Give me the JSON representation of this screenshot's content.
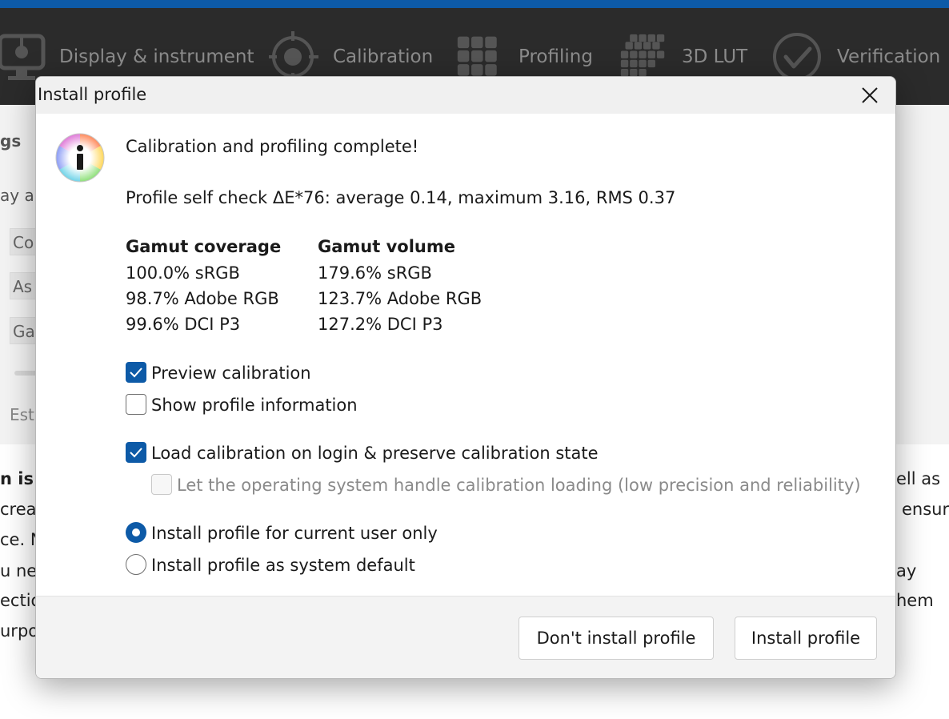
{
  "toolbar": {
    "items": [
      {
        "label": "Display & instrument",
        "icon": "display-icon"
      },
      {
        "label": "Calibration",
        "icon": "calibration-target-icon"
      },
      {
        "label": "Profiling",
        "icon": "profiling-grid-icon"
      },
      {
        "label": "3D LUT",
        "icon": "cube-icon"
      },
      {
        "label": "Verification",
        "icon": "checkmark-circle-icon"
      }
    ]
  },
  "background": {
    "heading": "gs",
    "sub": "ay a",
    "fields": [
      "Co",
      "As",
      "Ga"
    ],
    "est": "Est",
    "lines_left": [
      "n is",
      "crea",
      "ce. N",
      "u ne",
      "ectio",
      "urpos"
    ],
    "lines_right": [
      "ell as",
      "ensur",
      "ay",
      "hem"
    ]
  },
  "dialog": {
    "title": "Install profile",
    "headline": "Calibration and profiling complete!",
    "self_check": "Profile self check ΔE*76: average 0.14, maximum 3.16, RMS 0.37",
    "gamut_coverage": {
      "header": "Gamut coverage",
      "rows": [
        "100.0% sRGB",
        "98.7% Adobe RGB",
        "99.6% DCI P3"
      ]
    },
    "gamut_volume": {
      "header": "Gamut volume",
      "rows": [
        "179.6% sRGB",
        "123.7% Adobe RGB",
        "127.2% DCI P3"
      ]
    },
    "options": {
      "preview_calibration": {
        "label": "Preview calibration",
        "checked": true
      },
      "show_profile_info": {
        "label": "Show profile information",
        "checked": false
      },
      "load_calibration": {
        "label": "Load calibration on login & preserve calibration state",
        "checked": true
      },
      "os_handle": {
        "label": "Let the operating system handle calibration loading (low precision and reliability)",
        "checked": false,
        "disabled": true
      }
    },
    "install_scope": {
      "current_user": {
        "label": "Install profile for current user only",
        "selected": true
      },
      "system_default": {
        "label": "Install profile as system default",
        "selected": false
      }
    },
    "buttons": {
      "dont_install": "Don't install profile",
      "install": "Install profile"
    }
  },
  "colors": {
    "accent": "#0d5aa7",
    "toolbar_bg": "#2b2b2b"
  }
}
